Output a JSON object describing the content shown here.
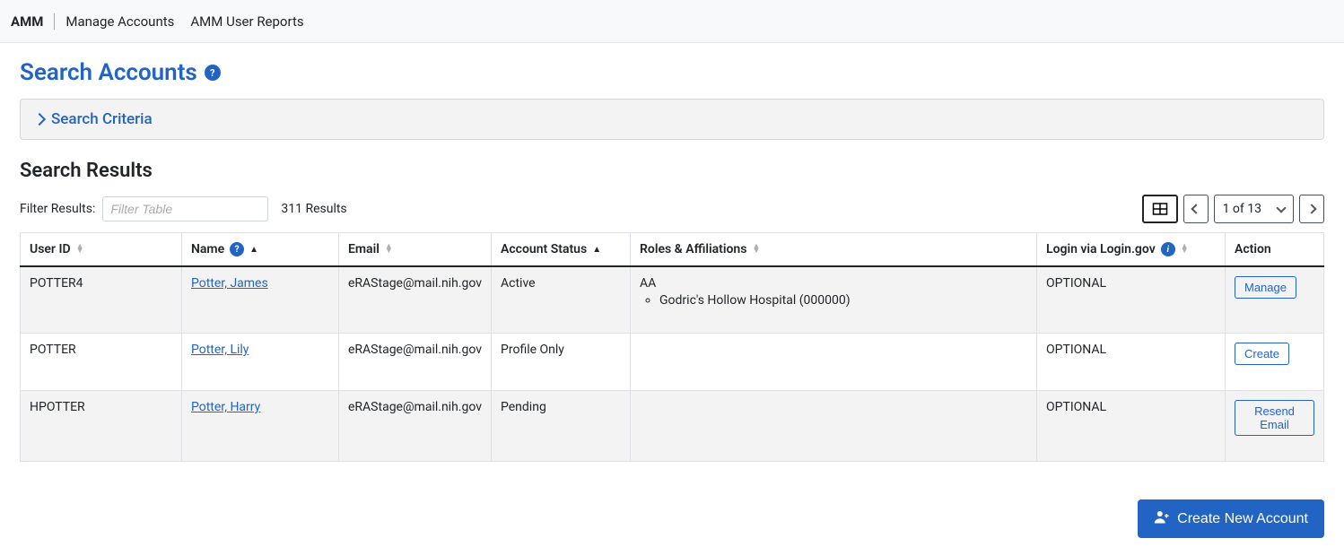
{
  "topbar": {
    "brand": "AMM",
    "links": [
      "Manage Accounts",
      "AMM User Reports"
    ]
  },
  "page": {
    "title": "Search Accounts",
    "criteria_label": "Search Criteria",
    "results_title": "Search Results"
  },
  "filter": {
    "label": "Filter Results:",
    "placeholder": "Filter Table",
    "count": "311 Results"
  },
  "pager": {
    "text": "1 of 13"
  },
  "columns": {
    "user_id": "User ID",
    "name": "Name",
    "email": "Email",
    "status": "Account Status",
    "roles": "Roles & Affiliations",
    "login": "Login via Login.gov",
    "action": "Action"
  },
  "rows": [
    {
      "user_id": "POTTER4",
      "name": "Potter, James",
      "email": "eRAStage@mail.nih.gov",
      "status": "Active",
      "role_code": "AA",
      "affiliation": "Godric's Hollow Hospital (000000)",
      "login": "OPTIONAL",
      "action": "Manage"
    },
    {
      "user_id": "POTTER",
      "name": "Potter, Lily",
      "email": "eRAStage@mail.nih.gov",
      "status": "Profile Only",
      "role_code": "",
      "affiliation": "",
      "login": "OPTIONAL",
      "action": "Create"
    },
    {
      "user_id": "HPOTTER",
      "name": "Potter, Harry",
      "email": "eRAStage@mail.nih.gov",
      "status": "Pending",
      "role_code": "",
      "affiliation": "",
      "login": "OPTIONAL",
      "action": "Resend Email"
    }
  ],
  "footer": {
    "create_label": "Create New Account"
  }
}
